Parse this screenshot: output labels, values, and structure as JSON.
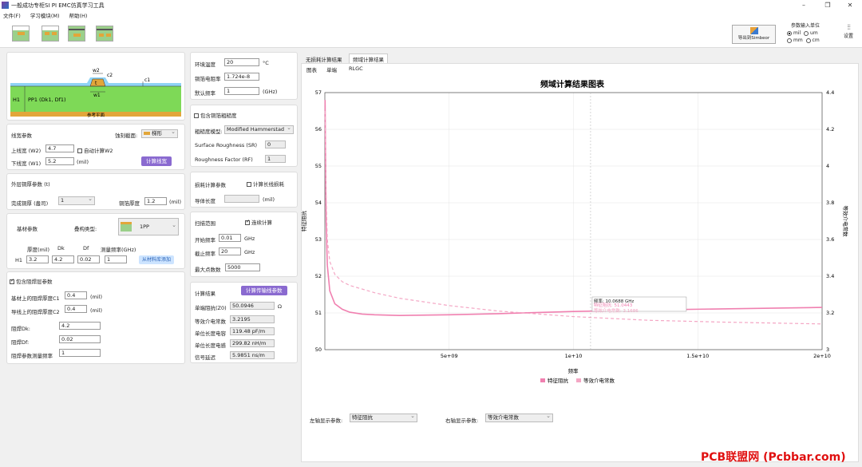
{
  "window": {
    "title": "一般成功专柜SI PI EMC仿真学习工具",
    "min": "–",
    "max": "❐",
    "close": "✕"
  },
  "menu": [
    "文件(F)",
    "学习模块(M)",
    "帮助(H)"
  ],
  "toolbar": {
    "export_label": "导出到Simbeor",
    "settings_label": "设置"
  },
  "units": {
    "title": "参数输入单位",
    "mil": "mil",
    "um": "um",
    "mm": "mm",
    "cm": "cm"
  },
  "cross": {
    "w2": "w2",
    "t": "t",
    "c2": "c2",
    "c1": "c1",
    "w1": "w1",
    "h1": "H1",
    "pp": "PP1 (Dk1, Df1)",
    "ref": "参考平面"
  },
  "line": {
    "title": "线宽参数",
    "shape_label": "蚀刻截面:",
    "shape_value": "梯形",
    "w2_label": "上线宽 (W2)",
    "w2_value": "4.7",
    "auto_w2": "自动计算W2",
    "w1_label": "下线宽 (W1)",
    "w1_value": "5.2",
    "unit": "(mil)",
    "calc_btn": "计算线宽"
  },
  "copper": {
    "title": "外层铜厚参数 (t)",
    "done_label": "完成铜厚 (盎司)",
    "done_value": "1",
    "thick_label": "铜箔厚度",
    "thick_value": "1.2",
    "unit": "(mil)"
  },
  "substrate": {
    "title": "基材参数",
    "stack_label": "叠构类型:",
    "stack_value": "1PP",
    "col_thick": "厚度(mil)",
    "col_dk": "Dk",
    "col_df": "Df",
    "col_freq": "测量频率(GHz)",
    "row_name": "H1",
    "thick": "3.2",
    "dk": "4.2",
    "df": "0.02",
    "freq": "1",
    "add_btn": "从材料库添加"
  },
  "solder": {
    "title": "包含阻焊层参数",
    "c1_label": "基材上的阻焊厚度C1",
    "c1_value": "0.4",
    "c2_label": "导线上的阻焊厚度C2",
    "c2_value": "0.4",
    "unit": "(mil)",
    "dk_label": "阻焊Dk:",
    "dk_value": "4.2",
    "df_label": "阻焊Df:",
    "df_value": "0.02",
    "freq_label": "阻焊参数测量频率",
    "freq_value": "1"
  },
  "env": {
    "temp_label": "环境温度",
    "temp_value": "20",
    "temp_unit": "°C",
    "res_label": "铜箔电阻率",
    "res_value": "1.724e-8",
    "freq_label": "默认频率",
    "freq_value": "1",
    "freq_unit": "(GHz)"
  },
  "rough": {
    "title": "包含铜箔粗糙度",
    "model_label": "粗糙度模型:",
    "model_value": "Modified Hammerstad",
    "sr_label": "Surface Roughness (SR)",
    "sr_value": "0",
    "rf_label": "Roughness Factor (RF)",
    "rf_value": "1"
  },
  "loss": {
    "title": "损耗计算参数",
    "long_loss": "计算长线损耗",
    "len_label": "导体长度",
    "unit": "(mil)"
  },
  "sweep": {
    "title": "扫描范围",
    "cont": "连续计算",
    "start_label": "开始频率",
    "start_value": "0.01",
    "start_unit": "GHz",
    "stop_label": "截止频率",
    "stop_value": "20",
    "stop_unit": "GHz",
    "pts_label": "最大点数数",
    "pts_value": "5000"
  },
  "result": {
    "title": "计算结果",
    "btn": "计算传输线参数",
    "z0_label": "单端阻抗(Z0)",
    "z0_value": "50.0946",
    "z0_unit": "Ω",
    "er_label": "等效介电常数",
    "er_value": "3.2195",
    "c_label": "单位长度电容",
    "c_value": "119.48 pF/m",
    "l_label": "单位长度电感",
    "l_value": "299.82 nH/m",
    "d_label": "信号延迟",
    "d_value": "5.9851 ns/m"
  },
  "tabs": {
    "t1": "无损耗计算结果",
    "t2": "频域计算结果",
    "s1": "图表",
    "s2": "单端",
    "s3": "RLGC"
  },
  "bottom": {
    "left_label": "左轴显示参数:",
    "left_value": "特征阻抗",
    "right_label": "右轴显示参数:",
    "right_value": "等效介电常数"
  },
  "watermark": "PCB联盟网 (Pcbbar.com)",
  "colors": {
    "z0": "#f080b0",
    "er": "#f4a6c4"
  },
  "chart_data": {
    "type": "line",
    "title": "频域计算结果图表",
    "xlabel": "频率",
    "ylabel": "特征阻抗",
    "y2label": "等效介电常数",
    "xlim": [
      0,
      20000000000
    ],
    "ylim": [
      50,
      57
    ],
    "y2lim": [
      3,
      4.4
    ],
    "x_ticks": [
      "5e+09",
      "1e+10",
      "1.5e+10",
      "2e+10"
    ],
    "y_ticks": [
      "50",
      "51",
      "52",
      "53",
      "54",
      "55",
      "56",
      "57"
    ],
    "y2_ticks": [
      "3",
      "3.2",
      "3.4",
      "3.6",
      "3.8",
      "4",
      "4.2",
      "4.4"
    ],
    "legend": "bottom-center",
    "series": [
      {
        "name": "特征阻抗",
        "axis": "left",
        "x": [
          10000000.0,
          50000000.0,
          100000000.0,
          200000000.0,
          400000000.0,
          700000000.0,
          1000000000.0,
          1500000000.0,
          2000000000.0,
          3000000000.0,
          5000000000.0,
          7000000000.0,
          10000000000.0,
          13000000000.0,
          16000000000.0,
          20000000000.0
        ],
        "values": [
          56.8,
          53.5,
          52.3,
          51.6,
          51.25,
          51.1,
          51.02,
          50.97,
          50.95,
          50.93,
          50.95,
          50.98,
          51.04,
          51.08,
          51.11,
          51.15
        ]
      },
      {
        "name": "等效介电常数",
        "axis": "right",
        "x": [
          10000000.0,
          50000000.0,
          100000000.0,
          200000000.0,
          400000000.0,
          700000000.0,
          1000000000.0,
          1500000000.0,
          2000000000.0,
          3000000000.0,
          5000000000.0,
          7000000000.0,
          10000000000.0,
          13000000000.0,
          16000000000.0,
          20000000000.0
        ],
        "values": [
          4.3,
          3.85,
          3.6,
          3.48,
          3.41,
          3.37,
          3.35,
          3.33,
          3.31,
          3.28,
          3.24,
          3.21,
          3.18,
          3.16,
          3.15,
          3.14
        ]
      }
    ],
    "annotation": {
      "x": 10688000000.0,
      "lines": [
        "频率: 10.0688 GHz",
        "特征阻抗: 51.0443",
        "等效介电常数: 3.1686"
      ]
    }
  }
}
